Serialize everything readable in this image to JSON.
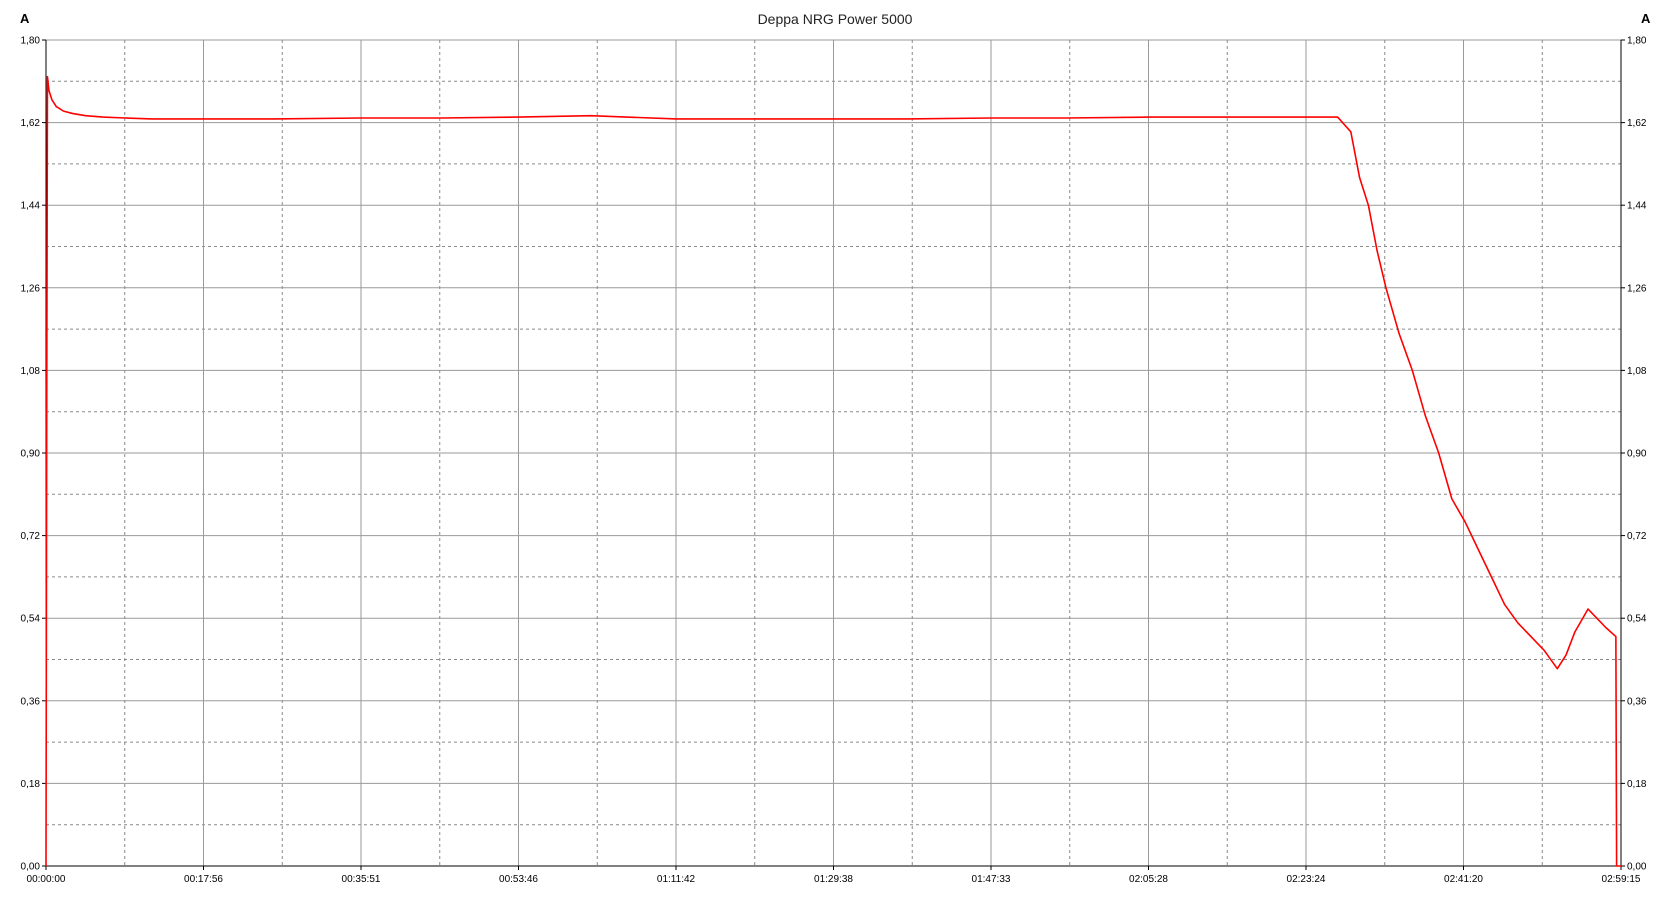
{
  "chart_data": {
    "type": "line",
    "title": "Deppa NRG Power 5000",
    "ylabel": "A",
    "ylabel_right": "A",
    "xlabel": "",
    "ylim": [
      0,
      1.8
    ],
    "yticks": [
      "0,00",
      "0,18",
      "0,36",
      "0,54",
      "0,72",
      "0,90",
      "1,08",
      "1,26",
      "1,44",
      "1,62",
      "1,80"
    ],
    "xticks": [
      "00:00:00",
      "00:17:56",
      "00:35:51",
      "00:53:46",
      "01:11:42",
      "01:29:38",
      "01:47:33",
      "02:05:28",
      "02:23:24",
      "02:41:20",
      "02:59:15"
    ],
    "grid": true,
    "series": [
      {
        "color": "#ff0000",
        "x": [
          "00:00:00",
          "00:00:05",
          "00:00:10",
          "00:00:20",
          "00:00:40",
          "00:01:10",
          "00:02:00",
          "00:03:00",
          "00:04:30",
          "00:06:30",
          "00:09:00",
          "00:12:00",
          "00:17:56",
          "00:26:00",
          "00:35:51",
          "00:45:00",
          "00:53:46",
          "01:02:00",
          "01:11:42",
          "01:20:00",
          "01:29:38",
          "01:38:00",
          "01:47:33",
          "01:56:00",
          "02:05:28",
          "02:14:00",
          "02:23:24",
          "02:27:00",
          "02:28:30",
          "02:29:30",
          "02:30:30",
          "02:31:30",
          "02:32:30",
          "02:34:00",
          "02:35:30",
          "02:37:00",
          "02:38:30",
          "02:40:00",
          "02:41:30",
          "02:43:00",
          "02:44:30",
          "02:46:00",
          "02:47:30",
          "02:49:00",
          "02:50:30",
          "02:52:00",
          "02:53:00",
          "02:54:00",
          "02:55:30",
          "02:56:30",
          "02:57:30",
          "02:58:40",
          "02:58:45",
          "02:59:15"
        ],
        "y": [
          0.0,
          1.0,
          1.72,
          1.69,
          1.67,
          1.655,
          1.645,
          1.64,
          1.635,
          1.632,
          1.63,
          1.628,
          1.628,
          1.628,
          1.63,
          1.63,
          1.632,
          1.635,
          1.628,
          1.628,
          1.628,
          1.628,
          1.63,
          1.63,
          1.632,
          1.632,
          1.632,
          1.632,
          1.6,
          1.5,
          1.44,
          1.34,
          1.26,
          1.16,
          1.08,
          0.98,
          0.9,
          0.8,
          0.75,
          0.69,
          0.63,
          0.57,
          0.53,
          0.5,
          0.47,
          0.43,
          0.46,
          0.51,
          0.56,
          0.54,
          0.52,
          0.5,
          0.0,
          0.0
        ]
      }
    ]
  }
}
